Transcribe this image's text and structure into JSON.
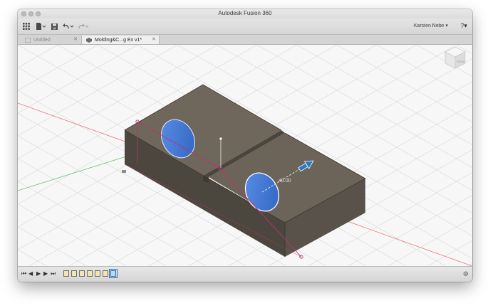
{
  "window": {
    "title": "Autodesk Fusion 360"
  },
  "toolbar": {
    "user_name": "Karsten Nebe ▾",
    "help_label": "?▾"
  },
  "tabs": [
    {
      "label": "Untitled",
      "close": "✕",
      "active": false
    },
    {
      "label": "Molding&C...g Ex v1*",
      "close": "✕",
      "active": true
    }
  ],
  "viewport": {
    "view_cube_face": "FRONT",
    "dimension_value": "40.00"
  },
  "timeline": {
    "controls": [
      "⏮",
      "◀",
      "▶",
      "▶",
      "⏭"
    ],
    "feature_count": 7,
    "settings_icon": "⚙"
  },
  "colors": {
    "body_top": "#6b6357",
    "body_front": "#4b463e",
    "body_side": "#58524a",
    "hole_face": "#3f7ad9",
    "sketch_line": "#c0306f",
    "grid": "#d9d9d9",
    "axis_red": "#e55b5b",
    "axis_green": "#58b558",
    "manipulator": "#2f79c2"
  }
}
